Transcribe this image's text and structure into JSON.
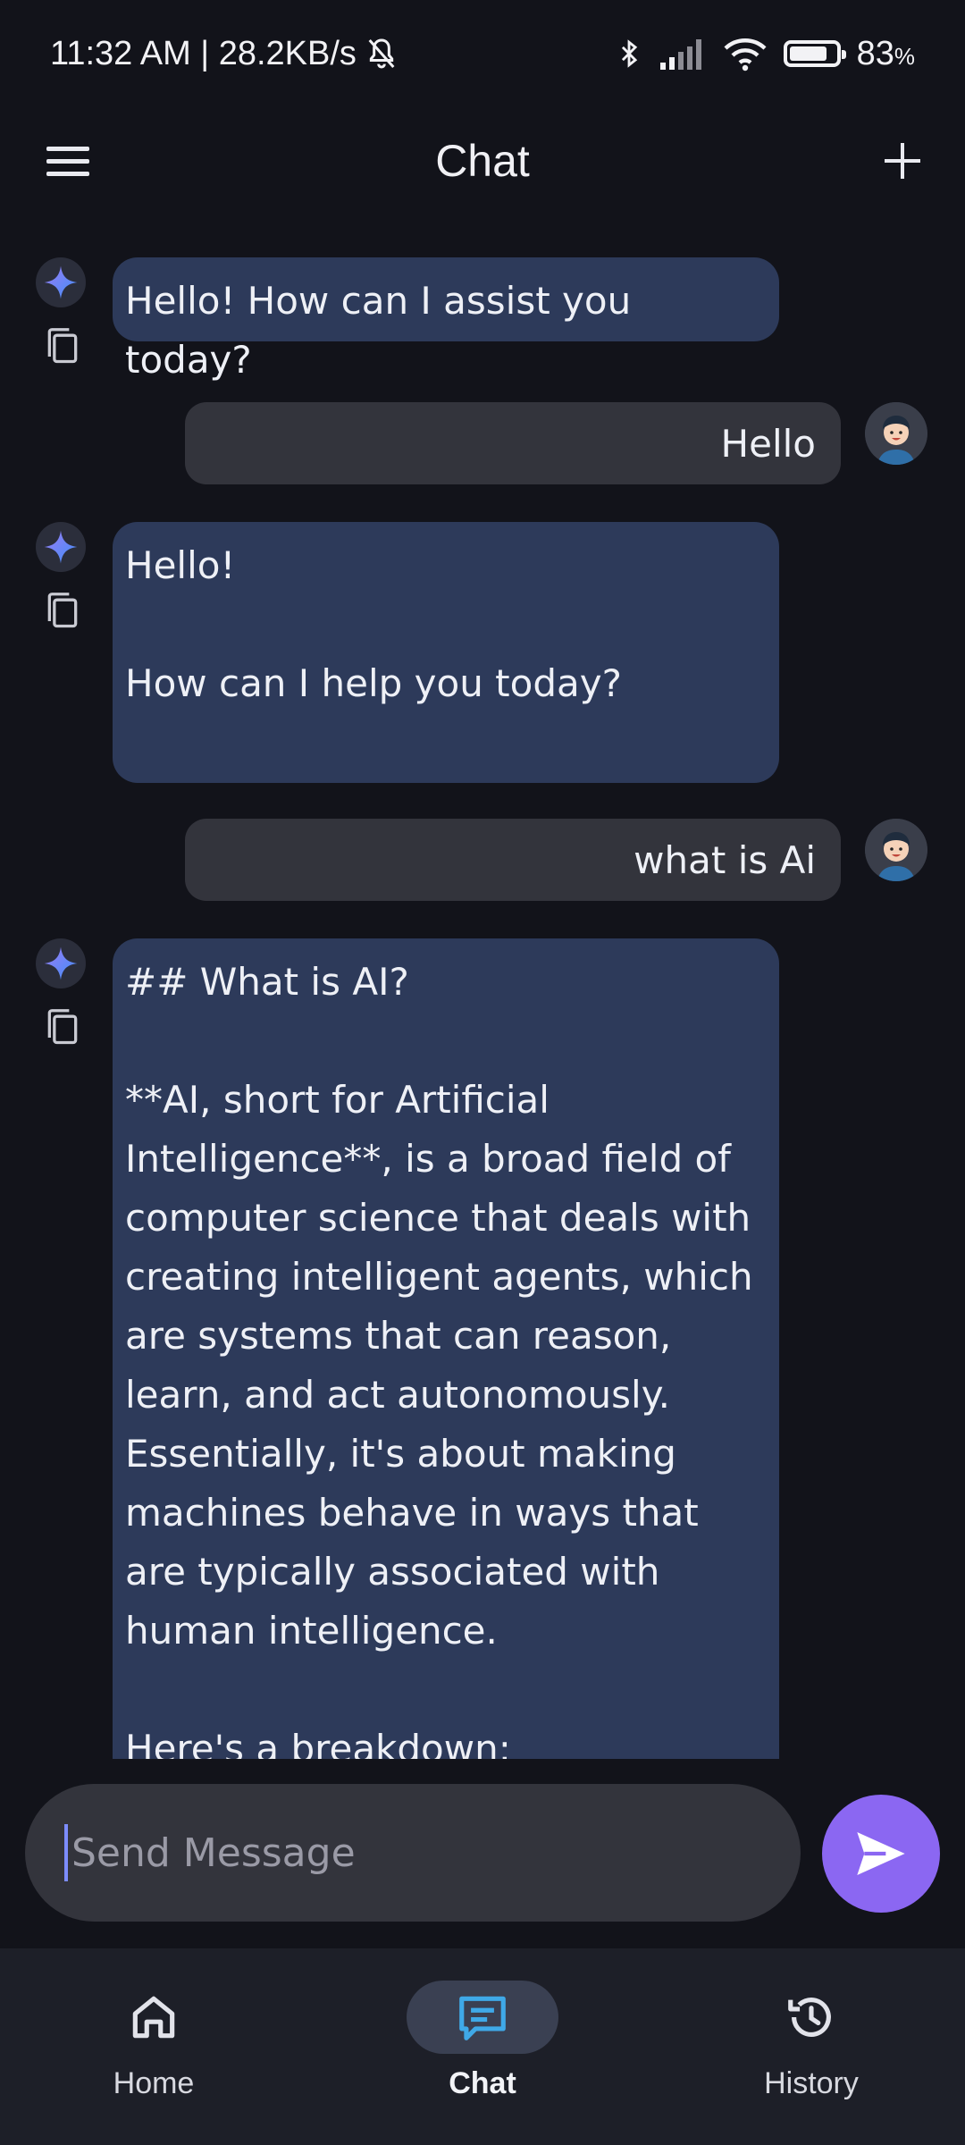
{
  "status_bar": {
    "time_speed": "11:32 AM | 28.2KB/s",
    "battery_percent": "83",
    "battery_unit": "%",
    "battery_level": 0.83,
    "icons": [
      "bell-off-icon",
      "bluetooth-icon",
      "signal-icon",
      "wifi-icon",
      "battery-icon"
    ]
  },
  "app_bar": {
    "title": "Chat",
    "menu_icon": "hamburger-menu-icon",
    "add_icon": "plus-icon"
  },
  "messages": [
    {
      "role": "assistant",
      "text": "Hello! How can I assist you today?"
    },
    {
      "role": "user",
      "text": "Hello"
    },
    {
      "role": "assistant",
      "text": "Hello!\n\nHow can I help you today?\n"
    },
    {
      "role": "user",
      "text": "what is Ai"
    },
    {
      "role": "assistant",
      "text": "## What is AI?\n\n**AI, short for Artificial Intelligence**, is a broad field of computer science that deals with creating intelligent agents, which are systems that can reason, learn, and act autonomously. Essentially, it's about making machines behave in ways that are typically associated with human intelligence.\n\nHere's a breakdown:"
    }
  ],
  "composer": {
    "placeholder": "Send Message",
    "value": "",
    "send_icon": "send-icon"
  },
  "bottom_nav": {
    "items": [
      {
        "label": "Home",
        "icon": "home-icon",
        "active": false
      },
      {
        "label": "Chat",
        "icon": "chat-bubble-icon",
        "active": true
      },
      {
        "label": "History",
        "icon": "history-icon",
        "active": false
      }
    ]
  },
  "colors": {
    "background": "#12131a",
    "assistant_bubble": "#2d3a5a",
    "user_bubble": "#33343c",
    "accent_send": "#8b67f2",
    "active_nav": "#3fa9e8"
  }
}
